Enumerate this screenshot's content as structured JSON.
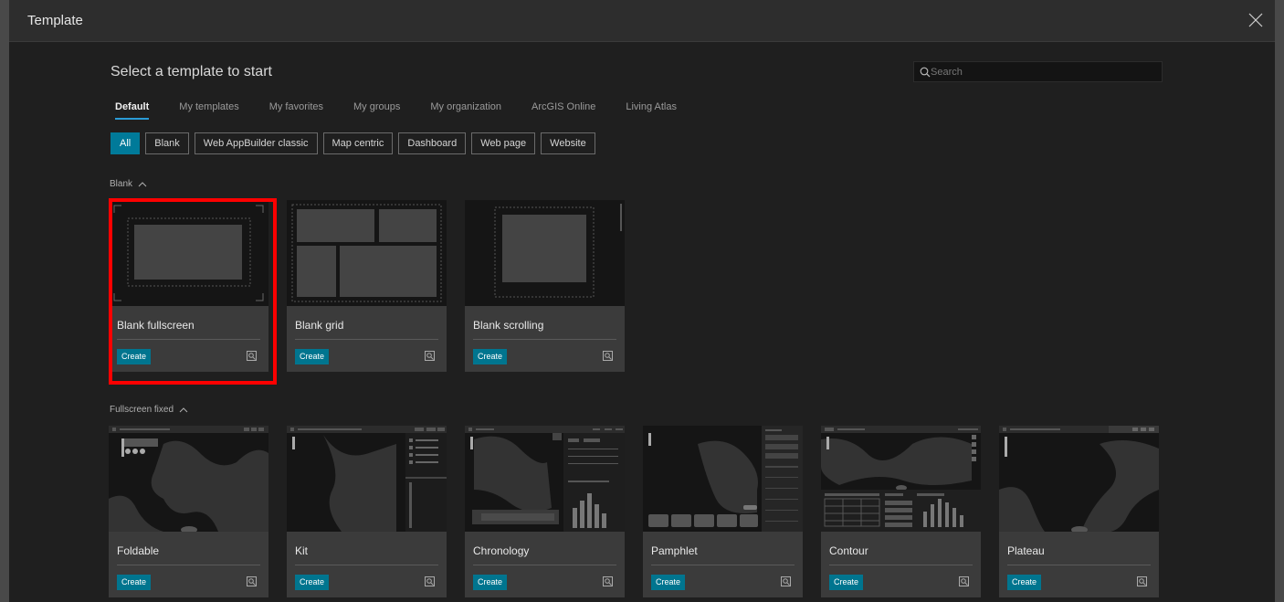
{
  "window": {
    "title": "Template"
  },
  "heading": "Select a template to start",
  "search": {
    "placeholder": "Search",
    "value": ""
  },
  "tabs": [
    {
      "label": "Default",
      "active": true
    },
    {
      "label": "My templates"
    },
    {
      "label": "My favorites"
    },
    {
      "label": "My groups"
    },
    {
      "label": "My organization"
    },
    {
      "label": "ArcGIS Online"
    },
    {
      "label": "Living Atlas"
    }
  ],
  "filters": [
    {
      "label": "All",
      "active": true
    },
    {
      "label": "Blank"
    },
    {
      "label": "Web AppBuilder classic"
    },
    {
      "label": "Map centric"
    },
    {
      "label": "Dashboard"
    },
    {
      "label": "Web page"
    },
    {
      "label": "Website"
    }
  ],
  "sections": [
    {
      "label": "Blank",
      "templates": [
        {
          "name": "Blank fullscreen",
          "create": "Create",
          "selected": true
        },
        {
          "name": "Blank grid",
          "create": "Create"
        },
        {
          "name": "Blank scrolling",
          "create": "Create"
        }
      ]
    },
    {
      "label": "Fullscreen fixed",
      "templates": [
        {
          "name": "Foldable",
          "create": "Create"
        },
        {
          "name": "Kit",
          "create": "Create"
        },
        {
          "name": "Chronology",
          "create": "Create"
        },
        {
          "name": "Pamphlet",
          "create": "Create"
        },
        {
          "name": "Contour",
          "create": "Create"
        },
        {
          "name": "Plateau",
          "create": "Create"
        }
      ]
    }
  ],
  "icons": {
    "close": "close-icon",
    "search": "search-icon",
    "preview": "preview-icon",
    "collapse": "chevron-up-icon"
  },
  "colors": {
    "accent": "#00758f",
    "active_chip": "#007a99",
    "tab_underline": "#2a9bd6",
    "selection": "#ff0000"
  }
}
